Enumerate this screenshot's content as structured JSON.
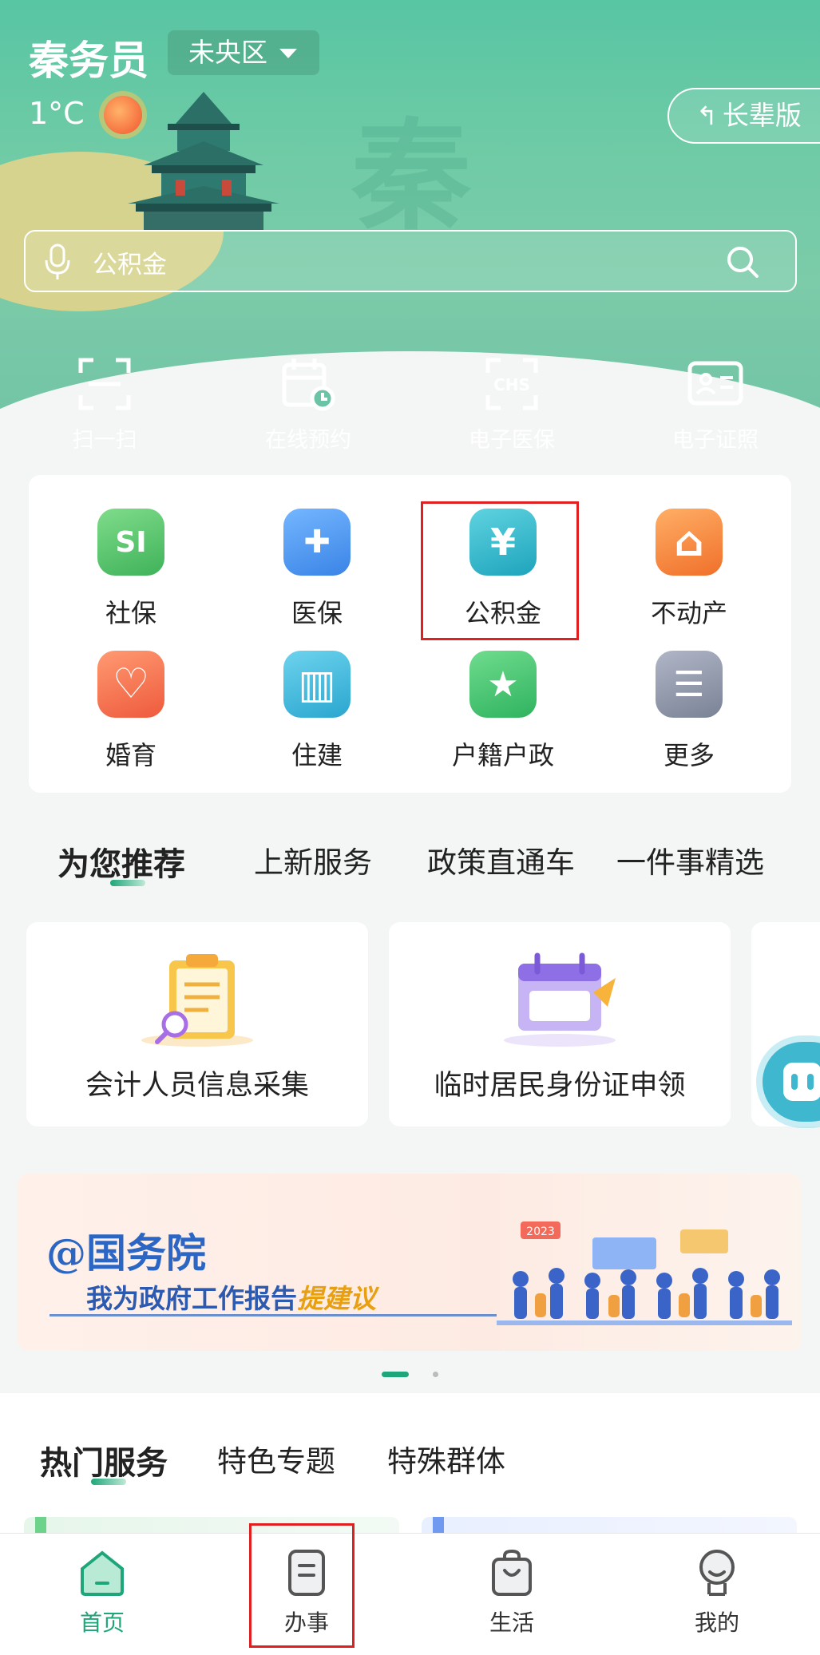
{
  "header": {
    "app_name": "秦务员",
    "district": "未央区",
    "temperature": "1°C",
    "elder_mode_label": "长辈版",
    "search_placeholder": "公积金"
  },
  "quick_actions": [
    {
      "label": "扫一扫",
      "icon": "scan-icon"
    },
    {
      "label": "在线预约",
      "icon": "calendar-clock-icon"
    },
    {
      "label": "电子医保",
      "icon": "chs-card-icon"
    },
    {
      "label": "电子证照",
      "icon": "id-card-icon"
    }
  ],
  "services": [
    {
      "label": "社保",
      "icon": "si-icon",
      "color": "#5cc46e",
      "glyph": "SI"
    },
    {
      "label": "医保",
      "icon": "shield-plus-icon",
      "color": "#4a9cf0",
      "glyph": "✚"
    },
    {
      "label": "公积金",
      "icon": "yuan-icon",
      "color": "#2bb6c9",
      "glyph": "¥"
    },
    {
      "label": "不动产",
      "icon": "house-icon",
      "color": "#f58a3a",
      "glyph": "⌂"
    },
    {
      "label": "婚育",
      "icon": "heart-icon",
      "color": "#f56a4a",
      "glyph": "♡"
    },
    {
      "label": "住建",
      "icon": "building-icon",
      "color": "#36b6d8",
      "glyph": "▥"
    },
    {
      "label": "户籍户政",
      "icon": "police-badge-icon",
      "color": "#3fbf6f",
      "glyph": "★"
    },
    {
      "label": "更多",
      "icon": "more-icon",
      "color": "#8e96a8",
      "glyph": "☰"
    }
  ],
  "recommend_tabs": [
    "为您推荐",
    "上新服务",
    "政策直通车",
    "一件事精选"
  ],
  "recommend_cards": [
    {
      "label": "会计人员信息采集",
      "icon": "clipboard-search-icon"
    },
    {
      "label": "临时居民身份证申领",
      "icon": "calendar-card-icon"
    }
  ],
  "banner": {
    "line1": "@国务院",
    "line2_prefix": "我为政府工作报告",
    "line2_emphasis": "提建议",
    "badge": "2023"
  },
  "hot_tabs": [
    "热门服务",
    "特色专题",
    "特殊群体"
  ],
  "bottom_nav": [
    {
      "label": "首页",
      "icon": "home-icon",
      "active": true
    },
    {
      "label": "办事",
      "icon": "document-icon",
      "active": false
    },
    {
      "label": "生活",
      "icon": "shopping-bag-icon",
      "active": false
    },
    {
      "label": "我的",
      "icon": "user-icon",
      "active": false
    }
  ],
  "colors": {
    "accent": "#1ea67a",
    "highlight_box": "#e02020",
    "header_bg": "#6fcba6"
  }
}
